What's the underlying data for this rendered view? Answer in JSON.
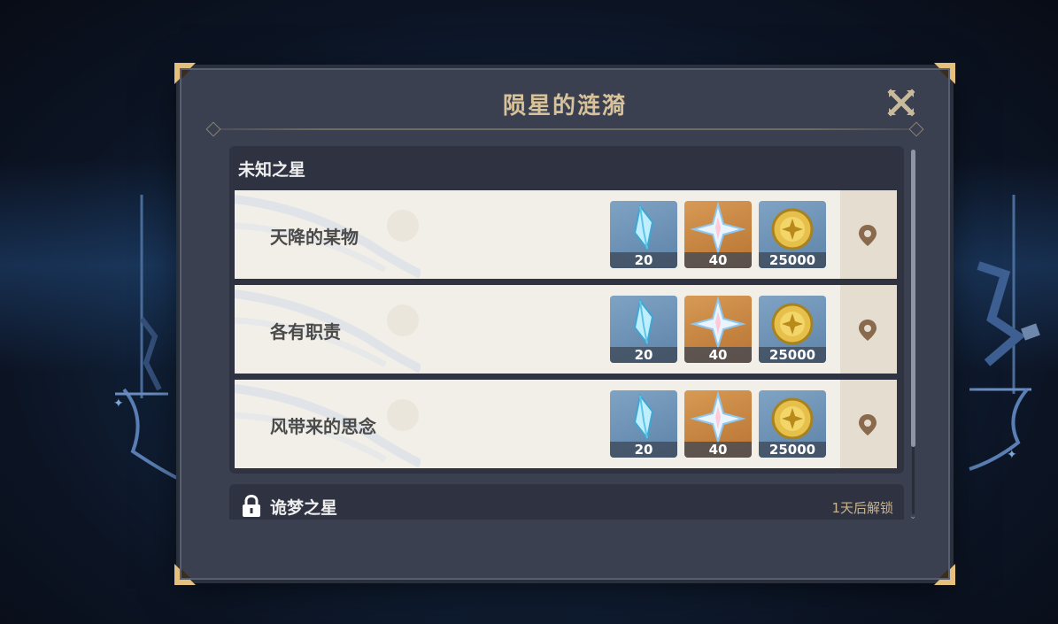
{
  "dialog": {
    "title": "陨星的涟漪",
    "close_icon": "close-x-icon"
  },
  "sections": [
    {
      "title": "未知之星",
      "locked": false,
      "rows": [
        {
          "label": "天降的某物",
          "rewards": [
            {
              "icon": "primogem-fragment-icon",
              "count": "20"
            },
            {
              "icon": "adventure-exp-star-icon",
              "count": "40"
            },
            {
              "icon": "mora-coin-icon",
              "count": "25000"
            }
          ],
          "action_icon": "location-pin-icon"
        },
        {
          "label": "各有职责",
          "rewards": [
            {
              "icon": "primogem-fragment-icon",
              "count": "20"
            },
            {
              "icon": "adventure-exp-star-icon",
              "count": "40"
            },
            {
              "icon": "mora-coin-icon",
              "count": "25000"
            }
          ],
          "action_icon": "location-pin-icon"
        },
        {
          "label": "风带来的思念",
          "rewards": [
            {
              "icon": "primogem-fragment-icon",
              "count": "20"
            },
            {
              "icon": "adventure-exp-star-icon",
              "count": "40"
            },
            {
              "icon": "mora-coin-icon",
              "count": "25000"
            }
          ],
          "action_icon": "location-pin-icon"
        }
      ]
    },
    {
      "title": "诡梦之星",
      "locked": true,
      "status": "1天后解锁",
      "icon": "lock-icon"
    }
  ],
  "colors": {
    "title_gold": "#d8c29a",
    "panel_bg": "#3a4050",
    "row_bg": "#f2efe8",
    "reward_blue": "#6a8fb2",
    "reward_orange": "#c8843f",
    "pin_brown": "#8a6a4c"
  }
}
